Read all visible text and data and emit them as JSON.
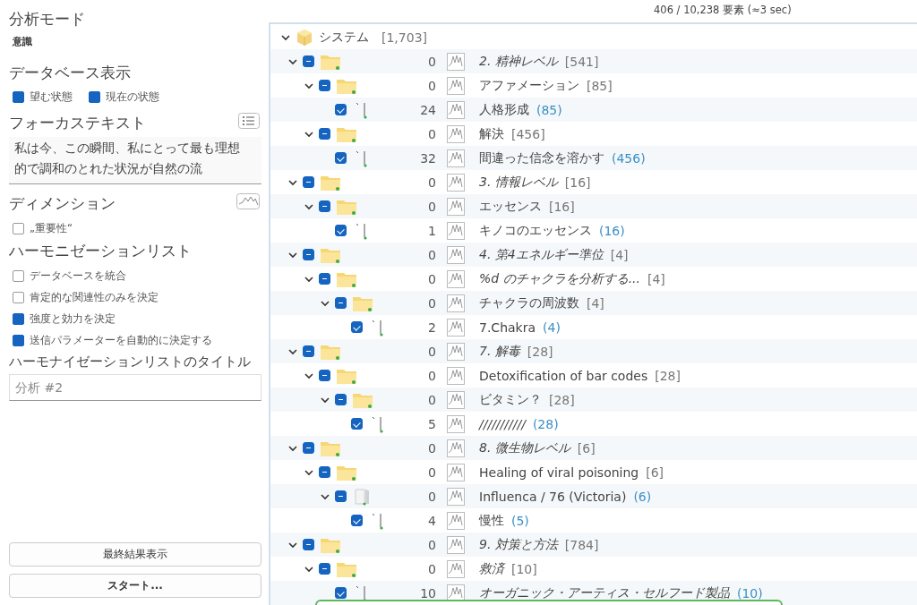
{
  "sidebar": {
    "analysis_mode": {
      "title": "分析モード",
      "value": "意識"
    },
    "database_view": {
      "title": "データベース表示",
      "options": [
        {
          "label": "望む状態",
          "checked": true
        },
        {
          "label": "現在の状態",
          "checked": true
        }
      ]
    },
    "focus_text": {
      "title": "フォーカステキスト",
      "value": "私は今、この瞬間、私にとって最も理想的で調和のとれた状況が自然の流"
    },
    "dimension": {
      "title": "ディメンション",
      "options": [
        {
          "label": "„重要性“",
          "checked": false
        }
      ]
    },
    "harmonization_list": {
      "title": "ハーモニゼーションリスト",
      "options": [
        {
          "label": "データベースを統合",
          "checked": false
        },
        {
          "label": "肯定的な関連性のみを決定",
          "checked": false
        },
        {
          "label": "強度と効力を決定",
          "checked": true
        },
        {
          "label": "送信パラメーターを自動的に決定する",
          "checked": true
        }
      ]
    },
    "list_title": {
      "title": "ハーモナイゼーションリストのタイトル",
      "placeholder": "分析 #2"
    },
    "buttons": [
      {
        "label": "最終結果表示",
        "kind": "normal"
      },
      {
        "label": "スタート...",
        "kind": "primary"
      }
    ]
  },
  "status": "406 / 10,238 要素 (≈3 sec)",
  "tree": {
    "label": "システム",
    "count": "[1,703]",
    "expanded": true,
    "children": [
      {
        "kind": "folder",
        "value": "0",
        "label": "2. 精神レベル",
        "count": "[541]",
        "italic": true,
        "expanded": true,
        "partial": true,
        "children": [
          {
            "kind": "folder",
            "value": "0",
            "label": "アファメーション",
            "count": "[85]",
            "italic": false,
            "expanded": true,
            "partial": true,
            "children": [
              {
                "kind": "leaf",
                "value": "24",
                "label": "人格形成",
                "count": "(85)",
                "italic": false,
                "checked": true
              }
            ]
          },
          {
            "kind": "folder",
            "value": "0",
            "label": "解決",
            "count": "[456]",
            "italic": false,
            "expanded": true,
            "partial": true,
            "children": [
              {
                "kind": "leaf",
                "value": "32",
                "label": "間違った信念を溶かす",
                "count": "(456)",
                "italic": false,
                "checked": true
              }
            ]
          }
        ]
      },
      {
        "kind": "folder",
        "value": "0",
        "label": "3. 情報レベル",
        "count": "[16]",
        "italic": true,
        "expanded": true,
        "partial": true,
        "children": [
          {
            "kind": "folder",
            "value": "0",
            "label": "エッセンス",
            "count": "[16]",
            "italic": false,
            "expanded": true,
            "partial": true,
            "children": [
              {
                "kind": "leaf",
                "value": "1",
                "label": "キノコのエッセンス",
                "count": "(16)",
                "italic": false,
                "checked": true
              }
            ]
          }
        ]
      },
      {
        "kind": "folder",
        "value": "0",
        "label": "4. 第4エネルギー準位",
        "count": "[4]",
        "italic": true,
        "expanded": true,
        "partial": true,
        "children": [
          {
            "kind": "folder",
            "value": "0",
            "label": "%d のチャクラを分析する...",
            "count": "[4]",
            "italic": true,
            "expanded": true,
            "partial": true,
            "children": [
              {
                "kind": "folder",
                "value": "0",
                "label": "チャクラの周波数",
                "count": "[4]",
                "italic": false,
                "expanded": true,
                "partial": true,
                "children": [
                  {
                    "kind": "leaf",
                    "value": "2",
                    "label": "7.Chakra",
                    "count": "(4)",
                    "italic": false,
                    "checked": true
                  }
                ]
              }
            ]
          }
        ]
      },
      {
        "kind": "folder",
        "value": "0",
        "label": "7. 解毒",
        "count": "[28]",
        "italic": true,
        "expanded": true,
        "partial": true,
        "children": [
          {
            "kind": "folder",
            "value": "0",
            "label": "Detoxification of bar codes",
            "count": "[28]",
            "italic": false,
            "expanded": true,
            "partial": true,
            "children": [
              {
                "kind": "folder",
                "value": "0",
                "label": "ビタミン？",
                "count": "[28]",
                "italic": false,
                "expanded": true,
                "partial": true,
                "children": [
                  {
                    "kind": "leaf",
                    "value": "5",
                    "label": "///////////",
                    "count": "(28)",
                    "italic": true,
                    "checked": true
                  }
                ]
              }
            ]
          }
        ]
      },
      {
        "kind": "folder",
        "value": "0",
        "label": "8. 微生物レベル",
        "count": "[6]",
        "italic": true,
        "expanded": true,
        "partial": true,
        "children": [
          {
            "kind": "folder",
            "value": "0",
            "label": "Healing of viral poisoning",
            "count": "[6]",
            "italic": false,
            "expanded": true,
            "partial": true,
            "children": [
              {
                "kind": "multi",
                "value": "0",
                "label": "Influenca / 76 (Victoria)",
                "count": "(6)",
                "italic": false,
                "expanded": true,
                "partial": true,
                "children": [
                  {
                    "kind": "leaf",
                    "value": "4",
                    "label": "慢性",
                    "count": "(5)",
                    "italic": false,
                    "checked": true
                  }
                ]
              }
            ]
          }
        ]
      },
      {
        "kind": "folder",
        "value": "0",
        "label": "9. 対策と方法",
        "count": "[784]",
        "italic": true,
        "expanded": true,
        "partial": true,
        "children": [
          {
            "kind": "folder",
            "value": "0",
            "label": "救済",
            "count": "[10]",
            "italic": true,
            "expanded": true,
            "partial": true,
            "children": [
              {
                "kind": "leaf",
                "value": "10",
                "label": "オーガニック・アーティス・セルフード製品",
                "count": "(10)",
                "italic": true,
                "checked": true
              }
            ]
          }
        ]
      }
    ]
  }
}
